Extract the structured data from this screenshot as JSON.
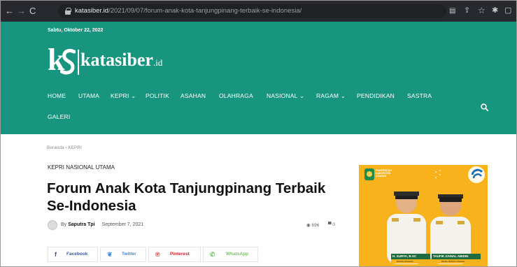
{
  "browser": {
    "url_domain": "katasiber.id",
    "url_path": "/2021/09/07/forum-anak-kota-tanjungpinang-terbaik-se-indonesia/"
  },
  "header": {
    "date": "Sabtu, Oktober 22, 2022",
    "logo_text": "katasiber",
    "logo_suffix": ".id",
    "bg_color": "#18957e"
  },
  "nav": {
    "items": [
      {
        "label": "HOME"
      },
      {
        "label": "UTAMA"
      },
      {
        "label": "KEPRI ⌄"
      },
      {
        "label": "POLITIK"
      },
      {
        "label": "ASAHAN"
      },
      {
        "label": "OLAHRAGA"
      },
      {
        "label": "NASIONAL ⌄"
      },
      {
        "label": "RAGAM ⌄"
      },
      {
        "label": "PENDIDIKAN"
      },
      {
        "label": "SASTRA"
      },
      {
        "label": "GALERI"
      }
    ]
  },
  "breadcrumb": {
    "home": "Beranda",
    "sep": "›",
    "current": "KEPRI"
  },
  "article": {
    "categories": "KEPRI NASIONAL UTAMA",
    "title_line1": "Forum Anak Kota Tanjungpinang Terbaik",
    "title_line2": "Se-Indonesia",
    "by": "By",
    "author": "Saputra Tpi",
    "date": "September 7, 2021",
    "views": "696",
    "comments": "0"
  },
  "share": {
    "facebook": "Facebook",
    "twitter": "Twitter",
    "pinterest": "Pinterest",
    "whatsapp": "WhatsApp",
    "colors": {
      "facebook": "#3b5998",
      "twitter": "#3a8ce5",
      "pinterest": "#ca212a",
      "whatsapp": "#7bbf6a"
    }
  },
  "ad": {
    "org_line1": "PEMERINTAH",
    "org_line2": "KABUPATEN",
    "org_line3": "ASAHAN",
    "name1": "H. SURYA, B.SC",
    "role1": "BUPATI ASAHAN",
    "name2": "TAUFIK ZAINAL ABIDIN",
    "role2": "WAKIL BUPATI ASAHAN",
    "bg_color": "#f7b21c"
  }
}
